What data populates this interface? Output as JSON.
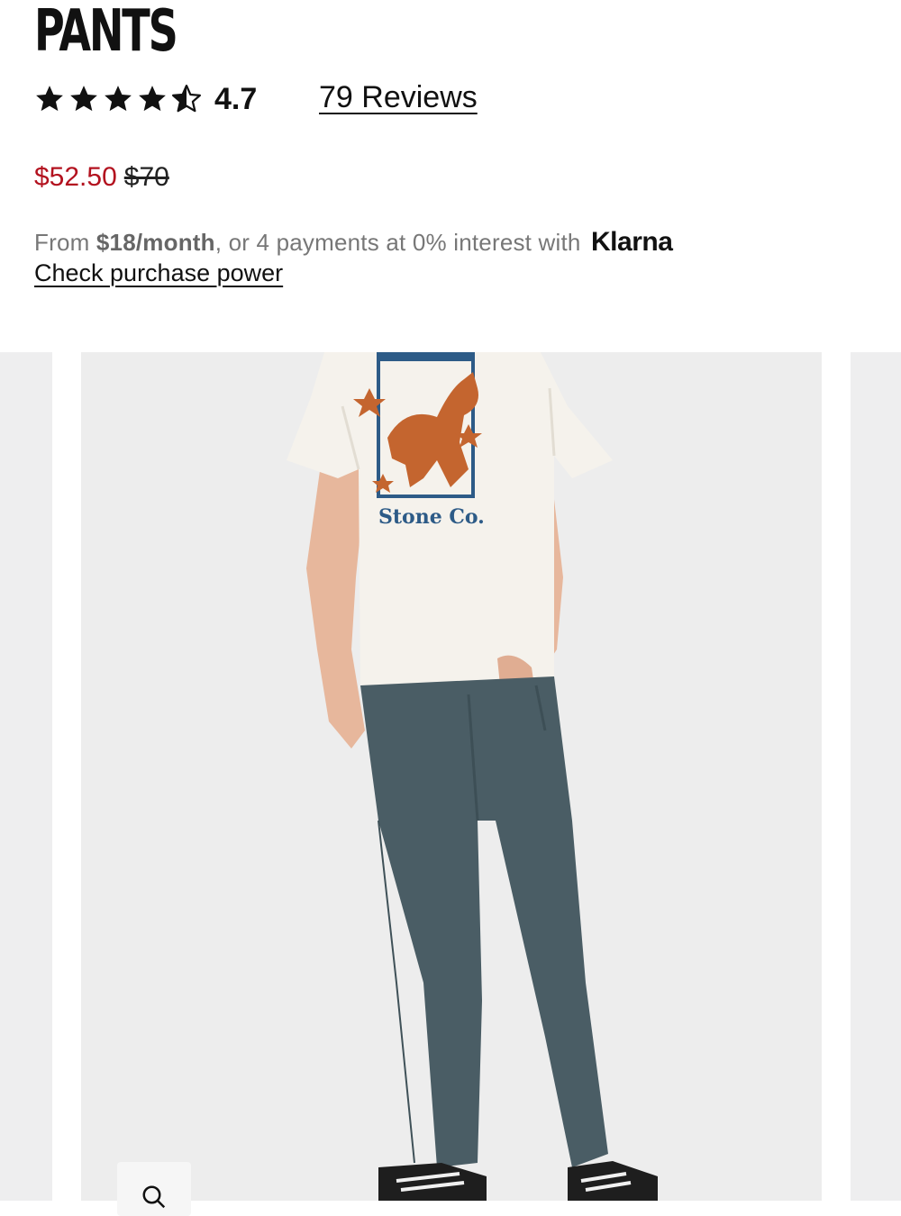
{
  "product": {
    "title": "PANTS",
    "rating": {
      "value": "4.7",
      "stars": 4.5,
      "max_stars": 5
    },
    "reviews_label": "79 Reviews",
    "price": {
      "sale": "$52.50",
      "original": "$70",
      "sale_color": "#b3121f"
    }
  },
  "klarna": {
    "prefix": "From ",
    "monthly": "$18/month",
    "suffix": ", or 4 payments at 0% interest with",
    "logo": "Klarna",
    "check_link": "Check purchase power"
  },
  "gallery": {
    "graphic_text": "Stone Co.",
    "zoom_icon": "search-icon"
  }
}
